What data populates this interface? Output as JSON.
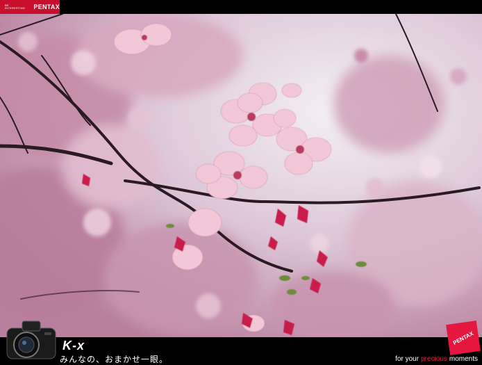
{
  "header": {
    "brand_tag": "BE INTERESTING",
    "brand_logo": "PENTAX"
  },
  "photo": {
    "subject_icon": "cherry-blossom-photo"
  },
  "footer": {
    "model_name": "K-x",
    "slogan": "みんなの、おまかせ一眼。",
    "tagline_prefix": "for your",
    "tagline_accent": "precious",
    "tagline_suffix": "moments",
    "badge_logo": "PENTAX"
  },
  "colors": {
    "brand_red": "#c8102e",
    "accent_red": "#e5173f",
    "background": "#000000"
  }
}
